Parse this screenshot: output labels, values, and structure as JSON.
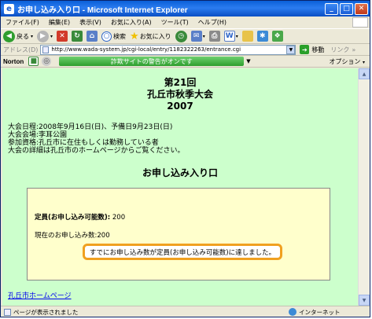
{
  "window": {
    "title": "お申し込み入り口 - Microsoft Internet Explorer"
  },
  "menu": [
    "ファイル(F)",
    "編集(E)",
    "表示(V)",
    "お気に入り(A)",
    "ツール(T)",
    "ヘルプ(H)"
  ],
  "toolbar": {
    "back_label": "戻る",
    "search_label": "検索",
    "favorites_label": "お気に入り"
  },
  "address": {
    "label": "アドレス(D)",
    "url": "http://www.wada-system.jp/cgi-local/entry/1182322263/entrance.cgi",
    "go_label": "移動",
    "links_label": "リンク"
  },
  "norton": {
    "brand": "Norton",
    "message": "詐欺サイトの警告がオンです",
    "options_label": "オプション"
  },
  "page": {
    "title_line1": "第21回",
    "title_line2": "孔丘市秋季大会",
    "title_line3": "2007",
    "info_date": "大会日程:2008年9月16日(日)、予備日9月23日(日)",
    "info_venue": "大会会場:李耳公園",
    "info_eligibility": "参加資格:孔丘市に在住もしくは勤務している者",
    "info_details": "大会の詳細は孔丘市のホームページからご覧ください。",
    "heading": "お申し込み入り口",
    "capacity_label": "定員(お申し込み可能数):",
    "capacity_value": "200",
    "current_label": "現在のお申し込み数:",
    "current_value": "200",
    "notice": "すでにお申し込み数が定員(お申し込み可能数)に達しました。",
    "home_link": "孔丘市ホームページ"
  },
  "status": {
    "text": "ページが表示されました",
    "zone": "インターネット"
  },
  "colors": {
    "content_bg": "#ccffcc",
    "panel_bg": "#ffffcc",
    "notice_border": "#f0a020",
    "link": "#0000ee",
    "titlebar": "#0a5fd8"
  }
}
